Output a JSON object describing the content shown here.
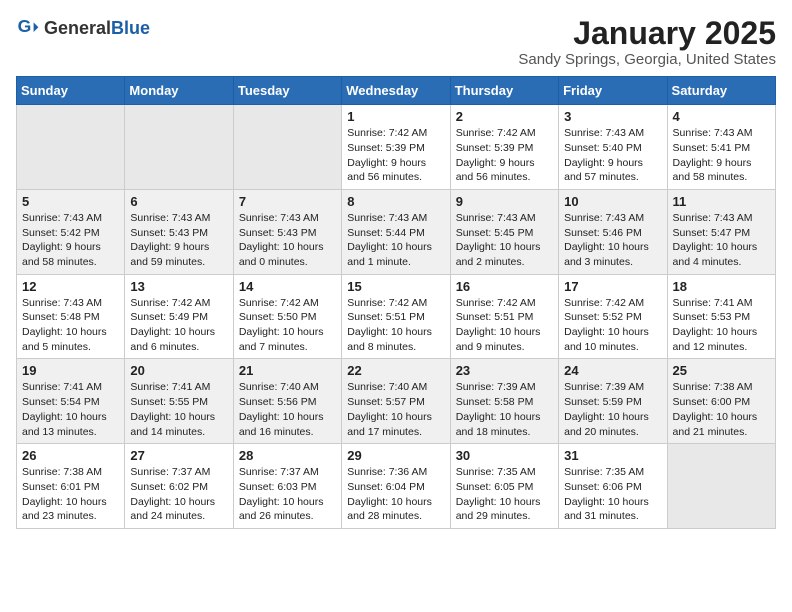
{
  "header": {
    "logo_general": "General",
    "logo_blue": "Blue",
    "title": "January 2025",
    "subtitle": "Sandy Springs, Georgia, United States"
  },
  "days_of_week": [
    "Sunday",
    "Monday",
    "Tuesday",
    "Wednesday",
    "Thursday",
    "Friday",
    "Saturday"
  ],
  "weeks": [
    [
      {
        "day": "",
        "info": ""
      },
      {
        "day": "",
        "info": ""
      },
      {
        "day": "",
        "info": ""
      },
      {
        "day": "1",
        "info": "Sunrise: 7:42 AM\nSunset: 5:39 PM\nDaylight: 9 hours\nand 56 minutes."
      },
      {
        "day": "2",
        "info": "Sunrise: 7:42 AM\nSunset: 5:39 PM\nDaylight: 9 hours\nand 56 minutes."
      },
      {
        "day": "3",
        "info": "Sunrise: 7:43 AM\nSunset: 5:40 PM\nDaylight: 9 hours\nand 57 minutes."
      },
      {
        "day": "4",
        "info": "Sunrise: 7:43 AM\nSunset: 5:41 PM\nDaylight: 9 hours\nand 58 minutes."
      }
    ],
    [
      {
        "day": "5",
        "info": "Sunrise: 7:43 AM\nSunset: 5:42 PM\nDaylight: 9 hours\nand 58 minutes."
      },
      {
        "day": "6",
        "info": "Sunrise: 7:43 AM\nSunset: 5:43 PM\nDaylight: 9 hours\nand 59 minutes."
      },
      {
        "day": "7",
        "info": "Sunrise: 7:43 AM\nSunset: 5:43 PM\nDaylight: 10 hours\nand 0 minutes."
      },
      {
        "day": "8",
        "info": "Sunrise: 7:43 AM\nSunset: 5:44 PM\nDaylight: 10 hours\nand 1 minute."
      },
      {
        "day": "9",
        "info": "Sunrise: 7:43 AM\nSunset: 5:45 PM\nDaylight: 10 hours\nand 2 minutes."
      },
      {
        "day": "10",
        "info": "Sunrise: 7:43 AM\nSunset: 5:46 PM\nDaylight: 10 hours\nand 3 minutes."
      },
      {
        "day": "11",
        "info": "Sunrise: 7:43 AM\nSunset: 5:47 PM\nDaylight: 10 hours\nand 4 minutes."
      }
    ],
    [
      {
        "day": "12",
        "info": "Sunrise: 7:43 AM\nSunset: 5:48 PM\nDaylight: 10 hours\nand 5 minutes."
      },
      {
        "day": "13",
        "info": "Sunrise: 7:42 AM\nSunset: 5:49 PM\nDaylight: 10 hours\nand 6 minutes."
      },
      {
        "day": "14",
        "info": "Sunrise: 7:42 AM\nSunset: 5:50 PM\nDaylight: 10 hours\nand 7 minutes."
      },
      {
        "day": "15",
        "info": "Sunrise: 7:42 AM\nSunset: 5:51 PM\nDaylight: 10 hours\nand 8 minutes."
      },
      {
        "day": "16",
        "info": "Sunrise: 7:42 AM\nSunset: 5:51 PM\nDaylight: 10 hours\nand 9 minutes."
      },
      {
        "day": "17",
        "info": "Sunrise: 7:42 AM\nSunset: 5:52 PM\nDaylight: 10 hours\nand 10 minutes."
      },
      {
        "day": "18",
        "info": "Sunrise: 7:41 AM\nSunset: 5:53 PM\nDaylight: 10 hours\nand 12 minutes."
      }
    ],
    [
      {
        "day": "19",
        "info": "Sunrise: 7:41 AM\nSunset: 5:54 PM\nDaylight: 10 hours\nand 13 minutes."
      },
      {
        "day": "20",
        "info": "Sunrise: 7:41 AM\nSunset: 5:55 PM\nDaylight: 10 hours\nand 14 minutes."
      },
      {
        "day": "21",
        "info": "Sunrise: 7:40 AM\nSunset: 5:56 PM\nDaylight: 10 hours\nand 16 minutes."
      },
      {
        "day": "22",
        "info": "Sunrise: 7:40 AM\nSunset: 5:57 PM\nDaylight: 10 hours\nand 17 minutes."
      },
      {
        "day": "23",
        "info": "Sunrise: 7:39 AM\nSunset: 5:58 PM\nDaylight: 10 hours\nand 18 minutes."
      },
      {
        "day": "24",
        "info": "Sunrise: 7:39 AM\nSunset: 5:59 PM\nDaylight: 10 hours\nand 20 minutes."
      },
      {
        "day": "25",
        "info": "Sunrise: 7:38 AM\nSunset: 6:00 PM\nDaylight: 10 hours\nand 21 minutes."
      }
    ],
    [
      {
        "day": "26",
        "info": "Sunrise: 7:38 AM\nSunset: 6:01 PM\nDaylight: 10 hours\nand 23 minutes."
      },
      {
        "day": "27",
        "info": "Sunrise: 7:37 AM\nSunset: 6:02 PM\nDaylight: 10 hours\nand 24 minutes."
      },
      {
        "day": "28",
        "info": "Sunrise: 7:37 AM\nSunset: 6:03 PM\nDaylight: 10 hours\nand 26 minutes."
      },
      {
        "day": "29",
        "info": "Sunrise: 7:36 AM\nSunset: 6:04 PM\nDaylight: 10 hours\nand 28 minutes."
      },
      {
        "day": "30",
        "info": "Sunrise: 7:35 AM\nSunset: 6:05 PM\nDaylight: 10 hours\nand 29 minutes."
      },
      {
        "day": "31",
        "info": "Sunrise: 7:35 AM\nSunset: 6:06 PM\nDaylight: 10 hours\nand 31 minutes."
      },
      {
        "day": "",
        "info": ""
      }
    ]
  ]
}
